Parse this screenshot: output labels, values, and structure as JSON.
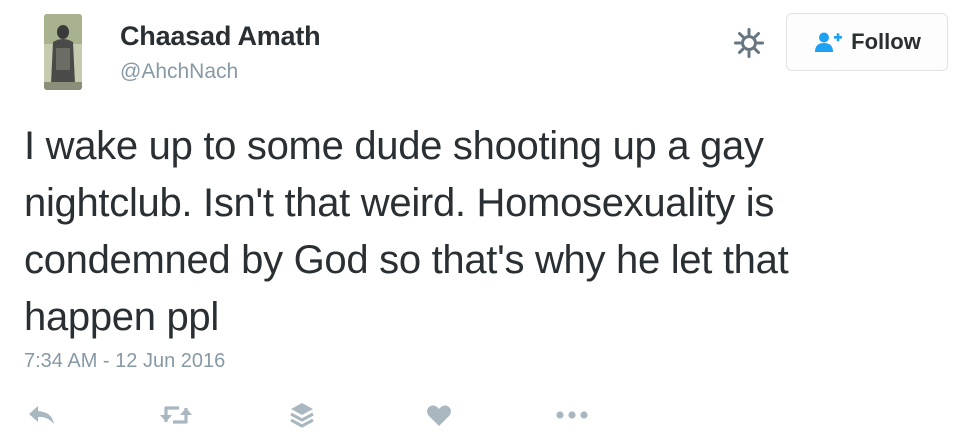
{
  "user": {
    "name": "Chaasad Amath",
    "handle": "@AhchNach"
  },
  "follow_button": {
    "label": "Follow",
    "icon": "add-user-icon"
  },
  "settings_icon": "gear-icon",
  "tweet": {
    "lines": [
      "I wake up to some dude shooting up a gay",
      "nightclub. Isn't that weird. Homosexuality is",
      "condemned by God so that's why he let that",
      "happen ppl"
    ],
    "timestamp": "7:34 AM - 12 Jun 2016"
  },
  "actions": [
    {
      "icon": "reply-icon"
    },
    {
      "icon": "retweet-icon"
    },
    {
      "icon": "stack-icon"
    },
    {
      "icon": "heart-icon"
    },
    {
      "icon": "more-icon"
    }
  ],
  "colors": {
    "text": "#292f33",
    "secondary": "#8899a6",
    "icon": "#a9b7c1",
    "accent": "#1da1f2"
  }
}
